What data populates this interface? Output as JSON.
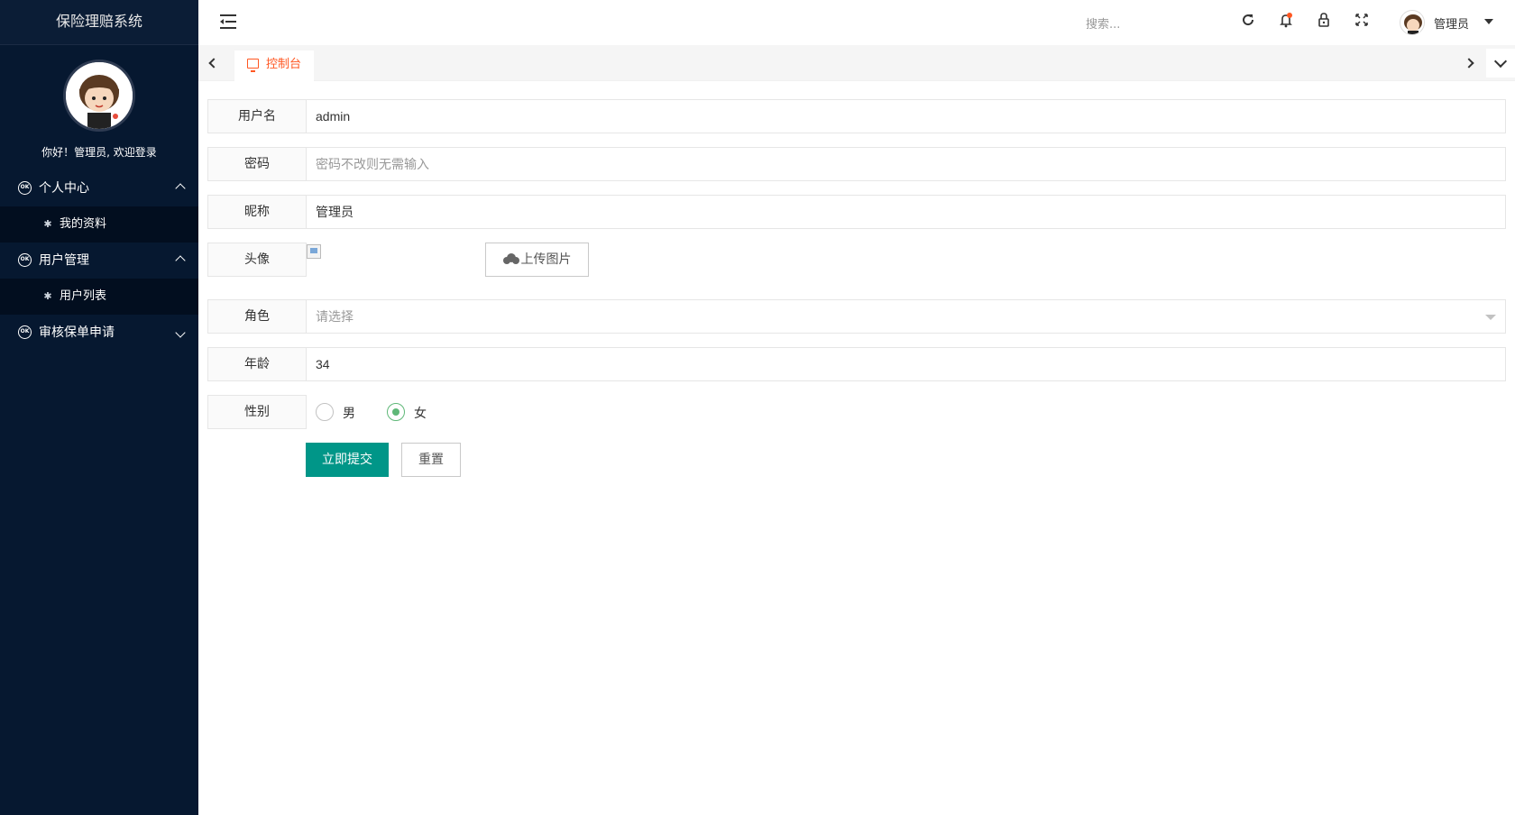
{
  "app": {
    "title": "保险理赔系统"
  },
  "sidebar": {
    "welcome": "你好！管理员, 欢迎登录",
    "groups": [
      {
        "label": "个人中心",
        "icon": "ok-icon",
        "expanded": true,
        "items": [
          {
            "label": "我的资料"
          }
        ]
      },
      {
        "label": "用户管理",
        "icon": "ok-icon",
        "expanded": true,
        "items": [
          {
            "label": "用户列表"
          }
        ]
      },
      {
        "label": "审核保单申请",
        "icon": "ok-icon",
        "expanded": false,
        "items": []
      }
    ]
  },
  "header": {
    "search_placeholder": "搜索...",
    "user_name": "管理员",
    "icons": [
      "menu-toggle-icon",
      "refresh-icon",
      "notification-bell-icon",
      "lock-icon",
      "fullscreen-icon"
    ]
  },
  "tabs": [
    {
      "label": "控制台",
      "icon": "monitor-icon",
      "active": true
    }
  ],
  "form": {
    "username": {
      "label": "用户名",
      "value": "admin"
    },
    "password": {
      "label": "密码",
      "placeholder": "密码不改则无需输入"
    },
    "nickname": {
      "label": "昵称",
      "value": "管理员"
    },
    "avatar": {
      "label": "头像",
      "upload_label": "上传图片"
    },
    "role": {
      "label": "角色",
      "placeholder": "请选择"
    },
    "age": {
      "label": "年龄",
      "value": "34"
    },
    "gender": {
      "label": "性别",
      "options": [
        "男",
        "女"
      ],
      "selected": "女"
    },
    "submit_label": "立即提交",
    "reset_label": "重置"
  },
  "colors": {
    "sidebar_bg": "#061830",
    "primary": "#009688",
    "tab_active": "#ff5722",
    "radio_checked": "#5fb878"
  }
}
